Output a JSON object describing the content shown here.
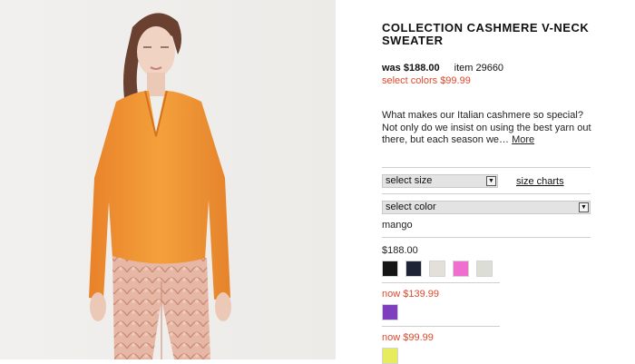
{
  "product": {
    "title": "COLLECTION CASHMERE V-NECK SWEATER",
    "was_price": "was $188.00",
    "item_number": "item 29660",
    "sale_text": "select colors $99.99",
    "description": "What makes our Italian cashmere so special? Not only do we insist on using the best yarn out there, but each season we…",
    "more_link": "More"
  },
  "selectors": {
    "size_label": "select size",
    "size_charts_label": "size charts",
    "color_label": "select color",
    "selected_color_name": "mango"
  },
  "price_groups": [
    {
      "price": "$188.00",
      "style": "regular",
      "swatches": [
        {
          "color": "#141414"
        },
        {
          "color": "#1e2435"
        },
        {
          "color": "#e3e0da"
        },
        {
          "color": "#ef6fcf"
        },
        {
          "color": "#dcddd6"
        }
      ]
    },
    {
      "price": "now $139.99",
      "style": "sale",
      "swatches": [
        {
          "color": "#7e3fbf"
        }
      ]
    },
    {
      "price": "now $99.99",
      "style": "sale",
      "swatches": [
        {
          "color": "#e6ec5e"
        }
      ]
    }
  ],
  "colors": {
    "sale_red": "#e0492c",
    "sweater_orange": "#f0932d",
    "pant_pink": "#e2b0a1"
  },
  "icons": {
    "dropdown_arrow": "chevron-down-icon"
  }
}
